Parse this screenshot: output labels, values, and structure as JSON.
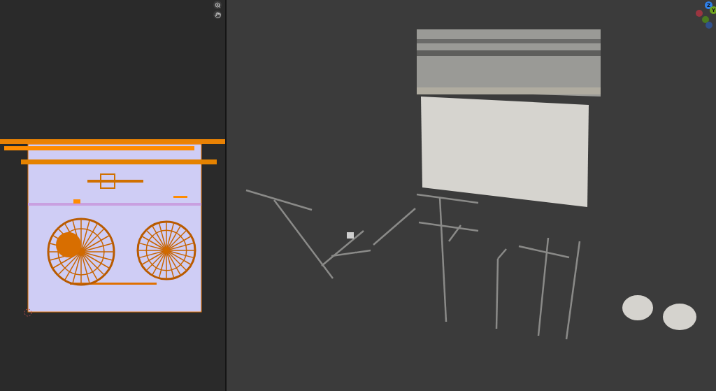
{
  "viewport_gizmo": {
    "axes": [
      {
        "label": "Z",
        "color": "#2f80e8"
      },
      {
        "label": "Y",
        "color": "#6ea21e"
      }
    ]
  }
}
